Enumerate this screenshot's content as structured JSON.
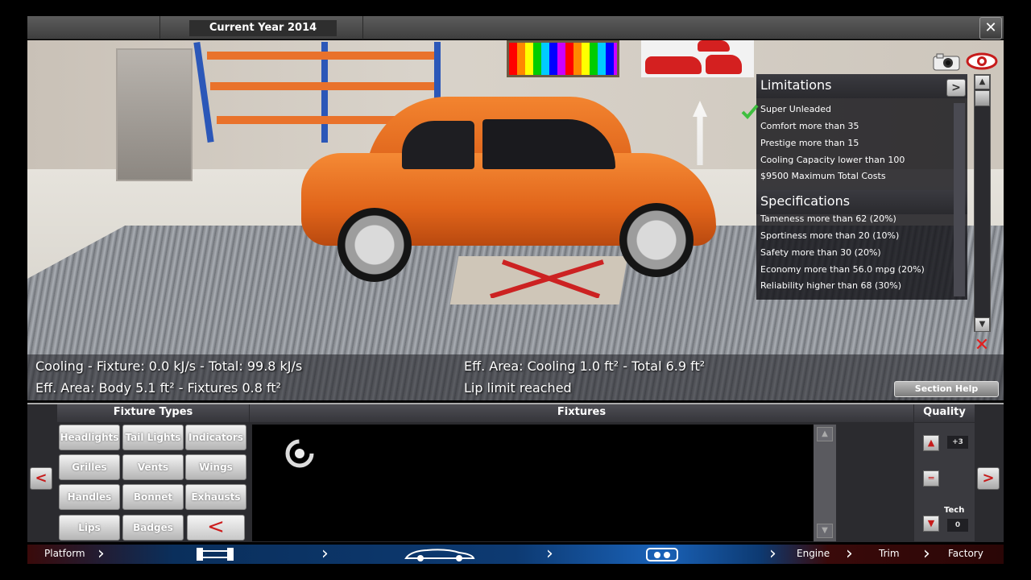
{
  "header": {
    "year_label": "Current Year 2014",
    "close_label": "✕"
  },
  "panel": {
    "limitations_title": "Limitations",
    "limitations": [
      "Super Unleaded",
      "Comfort more than 35",
      "Prestige more than 15",
      "Cooling Capacity lower than 100",
      "$9500 Maximum Total Costs"
    ],
    "specifications_title": "Specifications",
    "specifications": [
      "Tameness more than 62 (20%)",
      "Sportiness more than 20 (10%)",
      "Safety more than 30 (20%)",
      "Economy more than 56.0 mpg (20%)",
      "Reliability higher than 68 (30%)"
    ],
    "next_label": ">"
  },
  "info": {
    "cooling": "Cooling - Fixture: 0.0 kJ/s - Total: 99.8 kJ/s",
    "eff_area_body": "Eff. Area: Body 5.1 ft² - Fixtures 0.8 ft²",
    "eff_area_cooling": "Eff. Area: Cooling 1.0 ft² - Total 6.9 ft²",
    "lip_status": "Lip limit reached",
    "section_help": "Section Help"
  },
  "lower": {
    "fixture_types_title": "Fixture Types",
    "fixtures_title": "Fixtures",
    "quality_title": "Quality",
    "fixture_types": [
      "Headlights",
      "Tail Lights",
      "Indicators",
      "Grilles",
      "Vents",
      "Wings",
      "Handles",
      "Bonnet",
      "Exhausts",
      "Lips",
      "Badges"
    ],
    "back_label": "<",
    "prev_label": "<",
    "next_label": ">",
    "quality_value": "+3",
    "tech_label": "Tech",
    "tech_value": "0"
  },
  "nav": {
    "platform": "Platform",
    "engine": "Engine",
    "trim": "Trim",
    "factory": "Factory"
  },
  "colors": {
    "accent_red": "#cc1b1b",
    "car_orange": "#e6691f",
    "nav_blue": "#1a62b8"
  },
  "icons": [
    "camera-icon",
    "eye-icon",
    "checkmark-icon",
    "spinner-icon",
    "chassis-icon",
    "car-body-icon",
    "engine-icon"
  ]
}
